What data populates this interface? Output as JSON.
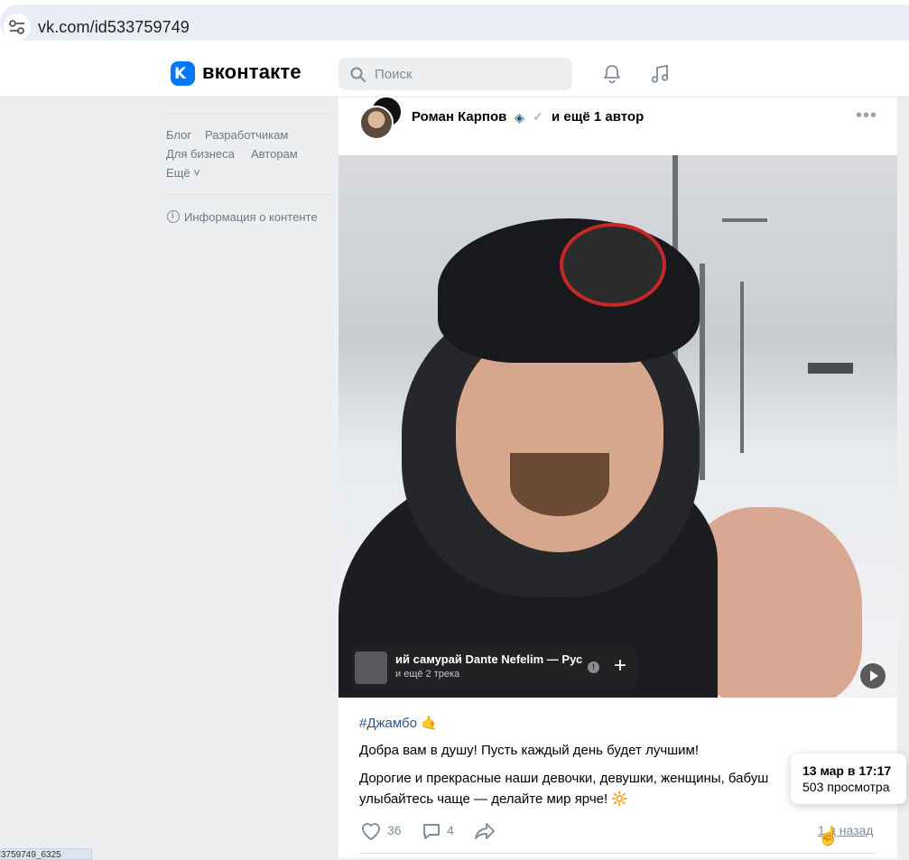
{
  "browser": {
    "url": "vk.com/id533759749"
  },
  "status_url": "3759749_6325",
  "header": {
    "logo_letter": "K",
    "logo_text": "вконтакте",
    "search_placeholder": "Поиск"
  },
  "leftnav": {
    "links_row1": [
      "Блог",
      "Разработчикам"
    ],
    "links_row2": [
      "Для бизнеса",
      "Авторам"
    ],
    "more": "Ещё ˅",
    "content_info": "Информация о контенте"
  },
  "post": {
    "author": "Роман Карпов",
    "coauthors": "и ещё 1 автор",
    "music": {
      "title": "ий самурай    Dante Nefelim — Рус",
      "subtitle": "и ещё 2 трека"
    },
    "hashtag": "#Джамбо 🤙",
    "line1": "Добра вам в душу! Пусть каждый день будет лучшим!",
    "line2": "Дорогие и прекрасные наши девочки, девушки, женщины, бабуш",
    "line3": "улыбайтесь чаще — делайте мир ярче! 🔆",
    "likes": "36",
    "comments": "4",
    "time": "1 д назад"
  },
  "tooltip": {
    "date": "13 мар в 17:17",
    "views": "503 просмотра"
  },
  "colors": {
    "accent": "#0077ff",
    "link": "#2a5885",
    "muted": "#818c99"
  }
}
